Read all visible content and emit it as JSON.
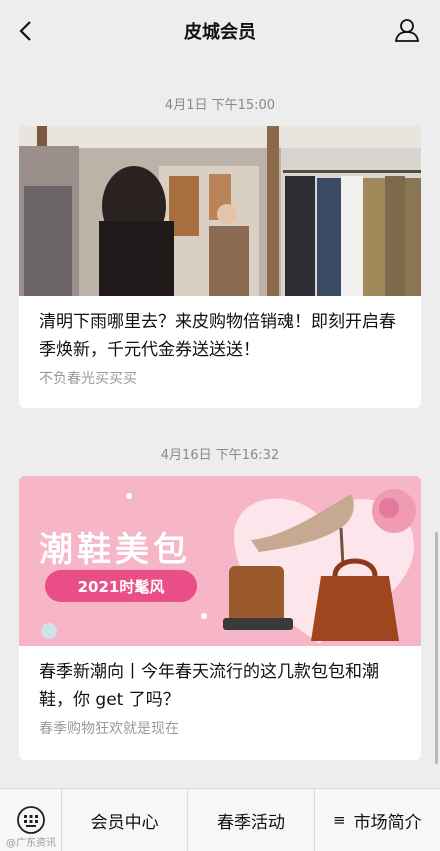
{
  "header": {
    "title": "皮城会员"
  },
  "messages": [
    {
      "timestamp": "4月1日 下午15:00",
      "headline": "清明下雨哪里去？来皮购物倍销魂！即刻开启春季焕新，千元代金券送送送！",
      "summary": "不负春光买买买"
    },
    {
      "timestamp": "4月16日 下午16:32",
      "banner_title": "潮鞋美包",
      "banner_tag": "2021时髦风",
      "headline": "春季新潮向丨今年春天流行的这几款包包和潮鞋，你 get 了吗？",
      "summary": "春季购物狂欢就是现在"
    }
  ],
  "menu": {
    "items": [
      "会员中心",
      "春季活动",
      "市场简介"
    ],
    "menu_lines_glyph": "≡"
  },
  "watermark": "@广东资讯"
}
